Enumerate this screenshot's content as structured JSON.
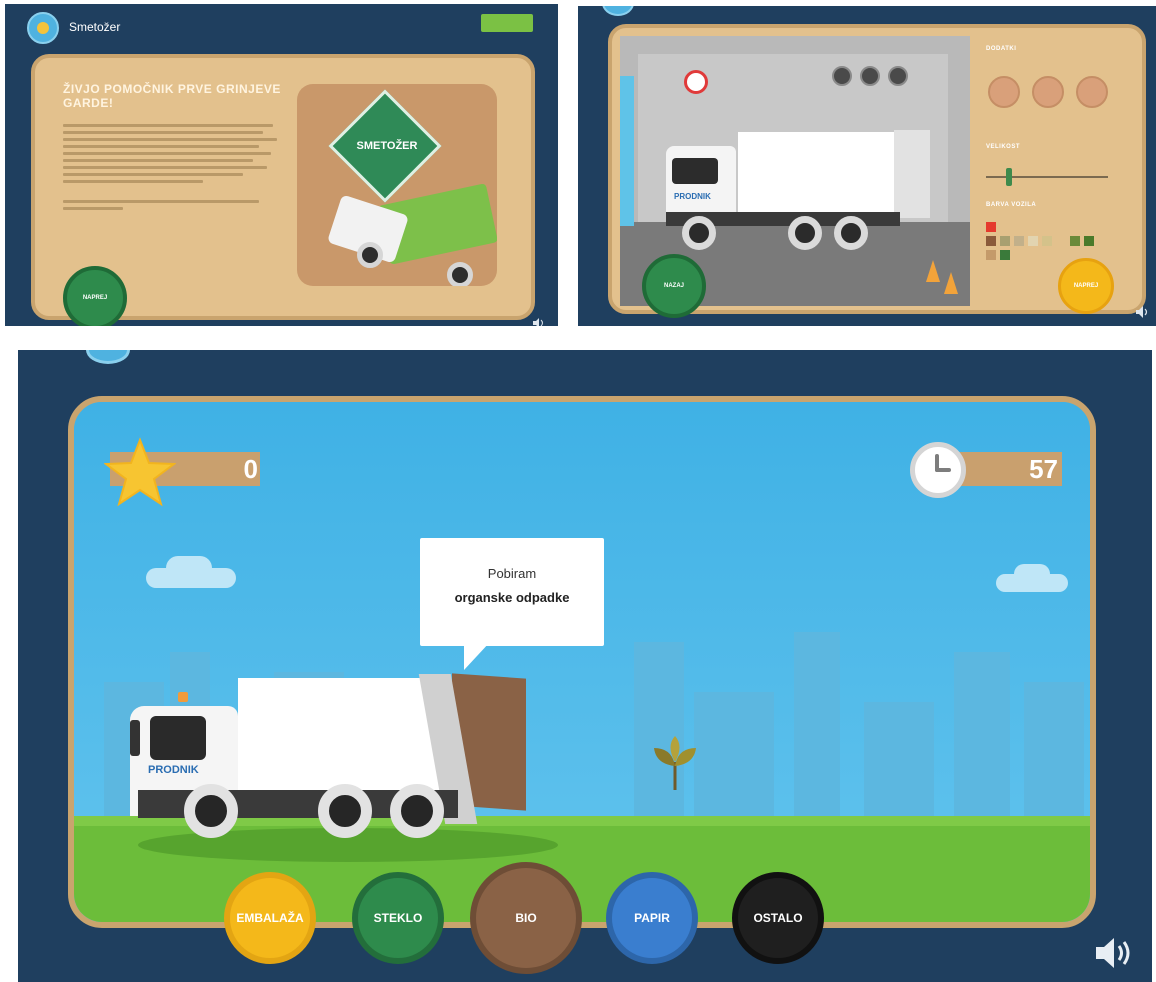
{
  "intro_screen": {
    "app_title": "Smetožer",
    "top_button_label": "",
    "heading": "ŽIVJO POMOČNIK PRVE GRINJEVE GARDE!",
    "logo_sign_text": "SMETOŽER",
    "start_button_label": "NAPREJ"
  },
  "customize_screen": {
    "section_parts_label": "DODATKI",
    "section_size_label": "VELIKOST",
    "section_color_label": "BARVA VOZILA",
    "truck_brand": "PRODNIK",
    "back_button_label": "NAZAJ",
    "next_button_label": "NAPREJ",
    "swatch_colors": [
      "#e53a2e",
      "#8a5a3a",
      "#a8a070",
      "#c2b08a",
      "#e2d4b0",
      "#d4c28a",
      "#6a8a3a",
      "#4a7a2a",
      "#c49a6a",
      "#3a7a3a"
    ]
  },
  "game_screen": {
    "score": "0",
    "time_left": "57",
    "speech_line1": "Pobiram",
    "speech_line2": "organske odpadke",
    "truck_brand": "PRODNIK",
    "bins": {
      "embalaza": "EMBALAŽA",
      "steklo": "STEKLO",
      "bio": "BIO",
      "papir": "PAPIR",
      "ostalo": "OSTALO"
    }
  },
  "colors": {
    "navy_background": "#1f3f5f",
    "panel_tan": "#e3c18d",
    "sky": "#3fb1e5",
    "grass": "#6cbd3a",
    "bin_yellow": "#f4b81a",
    "bin_green": "#2e8b4c",
    "bin_brown": "#8a6246",
    "bin_blue": "#3a7ecf",
    "bin_black": "#1f1f1f"
  }
}
